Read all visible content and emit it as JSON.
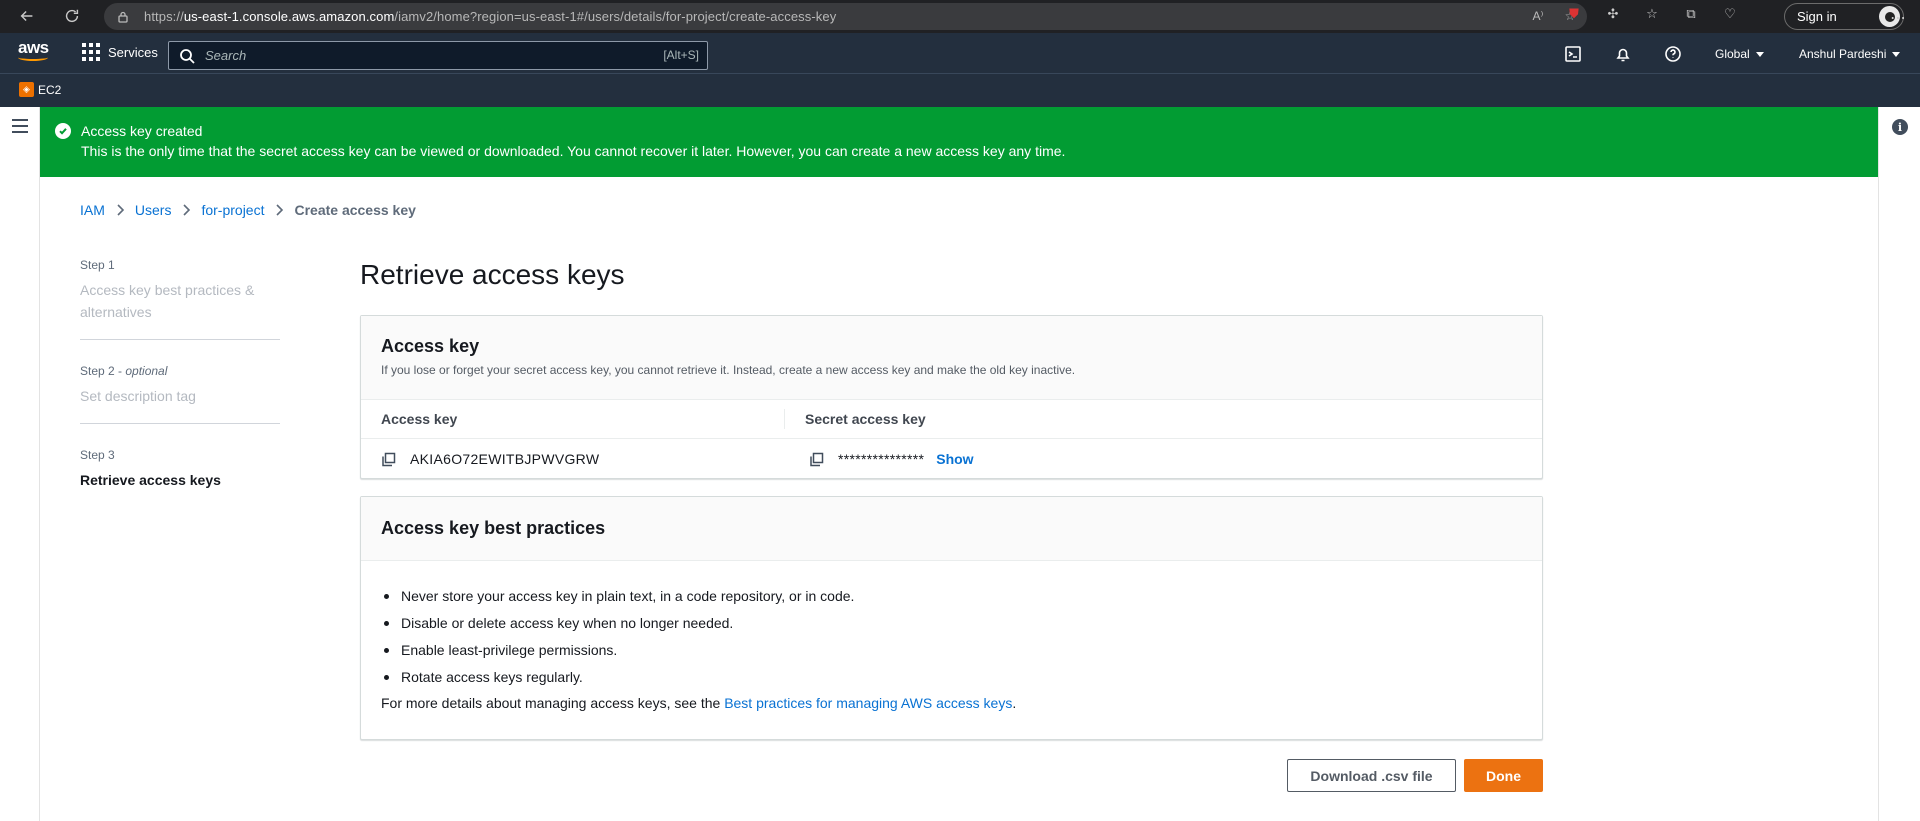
{
  "browser": {
    "url_prefix": "https://",
    "url_host": "us-east-1.console.aws.amazon.com",
    "url_path": "/iamv2/home?region=us-east-1#/users/details/for-project/create-access-key",
    "signin_label": "Sign in"
  },
  "aws_header": {
    "logo_text": "aws",
    "services_label": "Services",
    "search_placeholder": "Search",
    "search_shortcut": "[Alt+S]",
    "region_label": "Global",
    "user_label": "Anshul Pardeshi"
  },
  "favorites": {
    "ec2_label": "EC2"
  },
  "flash": {
    "title": "Access key created",
    "message": "This is the only time that the secret access key can be viewed or downloaded. You cannot recover it later. However, you can create a new access key any time.",
    "color": "#029c33"
  },
  "breadcrumb": {
    "items": [
      "IAM",
      "Users",
      "for-project"
    ],
    "current": "Create access key"
  },
  "steps": [
    {
      "num": "Step 1",
      "optional": "",
      "label": "Access key best practices & alternatives"
    },
    {
      "num": "Step 2 - ",
      "optional": "optional",
      "label": "Set description tag"
    },
    {
      "num": "Step 3",
      "optional": "",
      "label": "Retrieve access keys"
    }
  ],
  "page_title": "Retrieve access keys",
  "access_key_panel": {
    "title": "Access key",
    "description": "If you lose or forget your secret access key, you cannot retrieve it. Instead, create a new access key and make the old key inactive.",
    "col_access_key": "Access key",
    "col_secret_key": "Secret access key",
    "access_key_value": "AKIA6O72EWITBJPWVGRW",
    "secret_key_masked": "***************",
    "show_label": "Show"
  },
  "best_practices_panel": {
    "title": "Access key best practices",
    "items": [
      "Never store your access key in plain text, in a code repository, or in code.",
      "Disable or delete access key when no longer needed.",
      "Enable least-privilege permissions.",
      "Rotate access keys regularly."
    ],
    "more_prefix": "For more details about managing access keys, see the ",
    "more_link": "Best practices for managing AWS access keys",
    "more_suffix": "."
  },
  "actions": {
    "download_label": "Download .csv file",
    "done_label": "Done",
    "primary_color": "#ec7211"
  }
}
